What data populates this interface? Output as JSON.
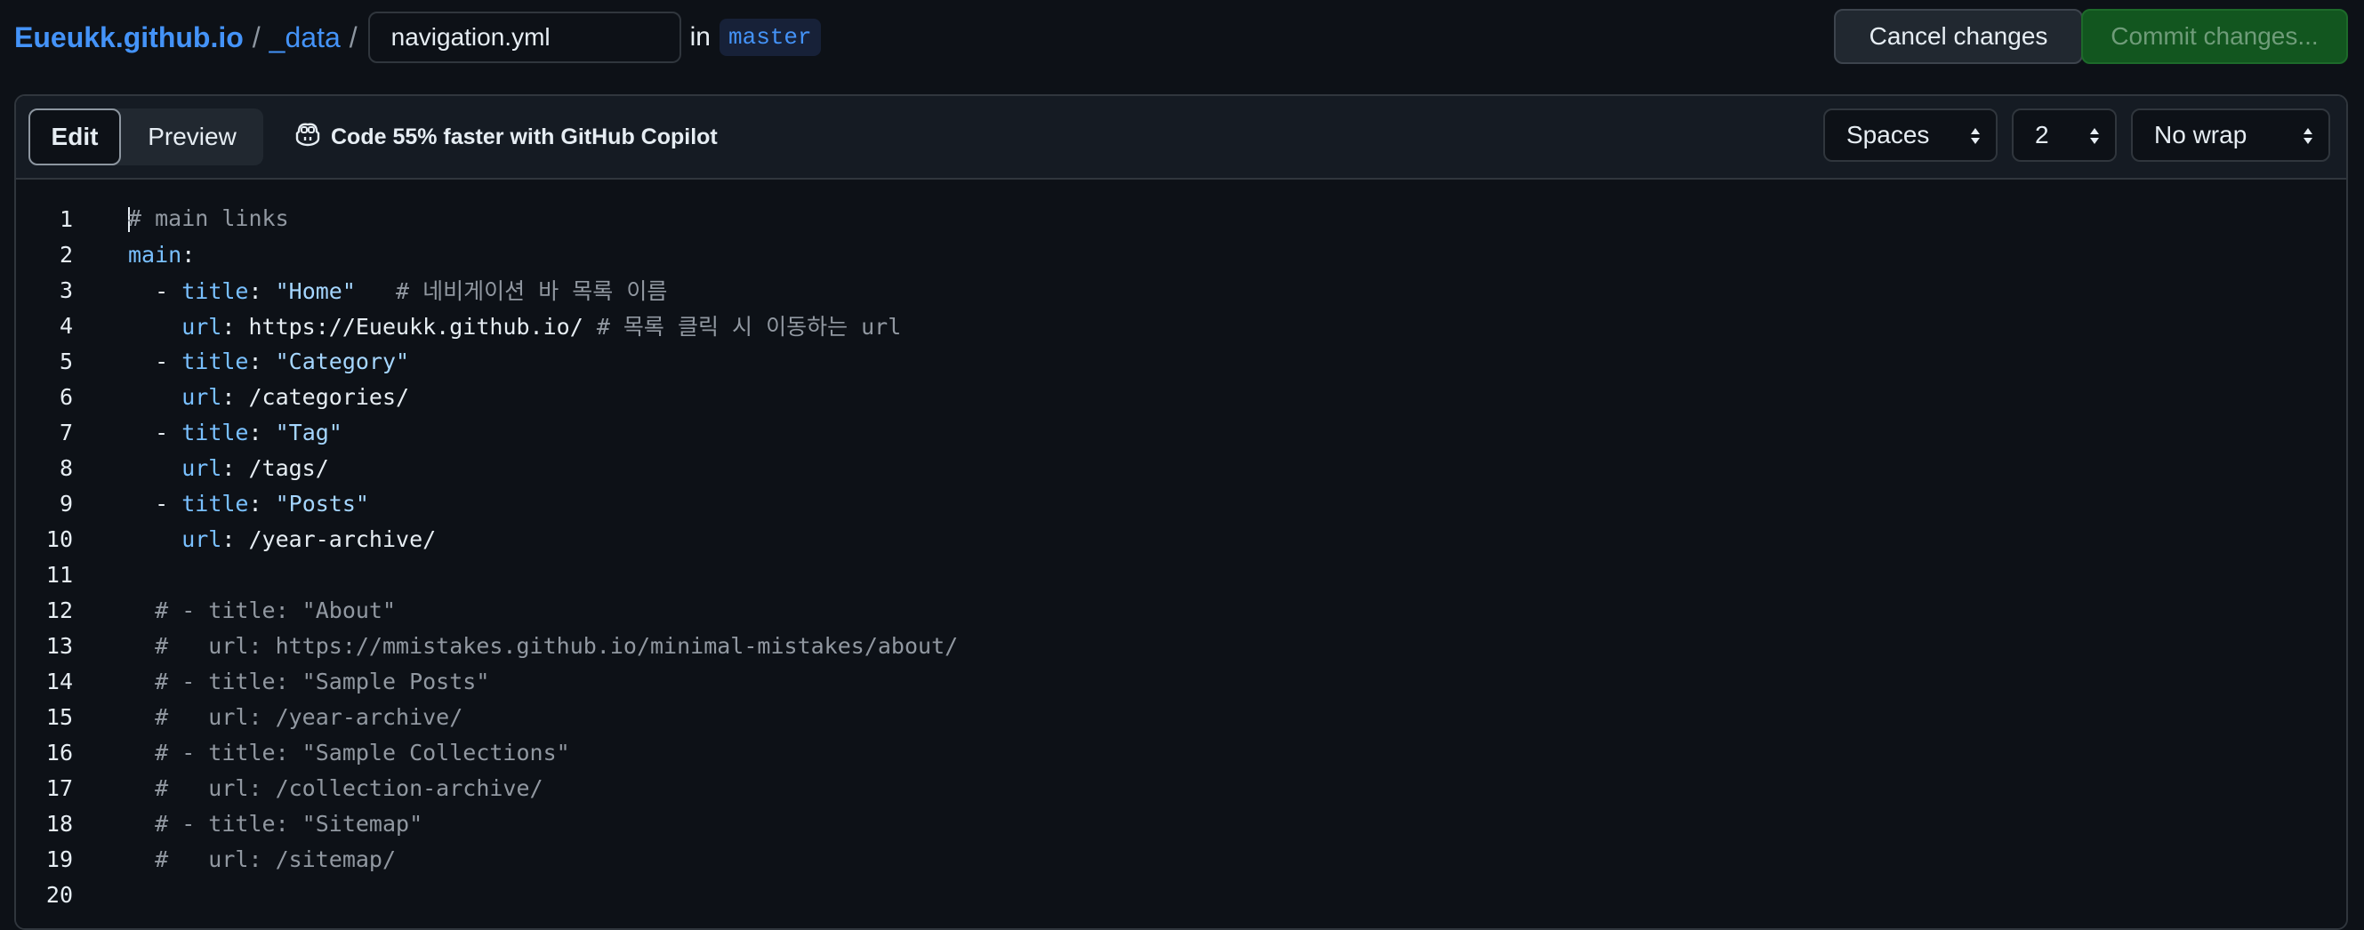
{
  "header": {
    "repo": "Eueukk.github.io",
    "separator": "/",
    "folder": "_data",
    "filename": "navigation.yml",
    "in_label": "in",
    "branch": "master",
    "cancel_label": "Cancel changes",
    "commit_label": "Commit changes..."
  },
  "toolbar": {
    "edit_tab": "Edit",
    "preview_tab": "Preview",
    "copilot_promo": "Code 55% faster with GitHub Copilot",
    "indent_mode": "Spaces",
    "indent_size": "2",
    "wrap_mode": "No wrap"
  },
  "editor": {
    "line_numbers": [
      "1",
      "2",
      "3",
      "4",
      "5",
      "6",
      "7",
      "8",
      "9",
      "10",
      "11",
      "12",
      "13",
      "14",
      "15",
      "16",
      "17",
      "18",
      "19",
      "20"
    ],
    "lines": {
      "l1_comment": "# main links",
      "l2_key": "main",
      "l2_colon": ":",
      "l3_dash": "  - ",
      "l3_key": "title",
      "l3_colon": ": ",
      "l3_value": "\"Home\"",
      "l3_comment": "   # 네비게이션 바 목록 이름",
      "l4_key": "    url",
      "l4_colon": ": ",
      "l4_value": "https://Eueukk.github.io/",
      "l4_comment": " # 목록 클릭 시 이동하는 url",
      "l5_dash": "  - ",
      "l5_key": "title",
      "l5_colon": ": ",
      "l5_value": "\"Category\"",
      "l6_key": "    url",
      "l6_colon": ": ",
      "l6_value": "/categories/",
      "l7_dash": "  - ",
      "l7_key": "title",
      "l7_colon": ": ",
      "l7_value": "\"Tag\"",
      "l8_key": "    url",
      "l8_colon": ": ",
      "l8_value": "/tags/",
      "l9_dash": "  - ",
      "l9_key": "title",
      "l9_colon": ": ",
      "l9_value": "\"Posts\"",
      "l10_key": "    url",
      "l10_colon": ": ",
      "l10_value": "/year-archive/",
      "l12": "  # - title: \"About\"",
      "l13": "  #   url: https://mmistakes.github.io/minimal-mistakes/about/",
      "l14": "  # - title: \"Sample Posts\"",
      "l15": "  #   url: /year-archive/",
      "l16": "  # - title: \"Sample Collections\"",
      "l17": "  #   url: /collection-archive/",
      "l18": "  # - title: \"Sitemap\"",
      "l19": "  #   url: /sitemap/"
    }
  },
  "colors": {
    "background": "#0d1117",
    "link": "#4493f8",
    "commit_button": "#12561f",
    "yaml_key": "#79c0ff",
    "yaml_string": "#a5d6ff",
    "comment": "#9198a1"
  },
  "icons": {
    "copilot": "copilot-icon",
    "select_caret": "updown-caret-icon"
  }
}
